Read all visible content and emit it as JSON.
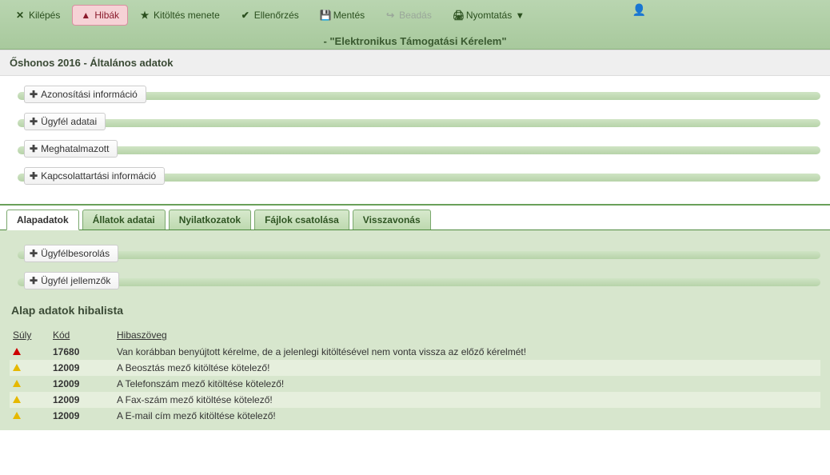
{
  "toolbar": {
    "exit": "Kilépés",
    "errors": "Hibák",
    "fillGuide": "Kitöltés menete",
    "check": "Ellenőrzés",
    "save": "Mentés",
    "submit": "Beadás",
    "print": "Nyomtatás"
  },
  "header": {
    "subtitle": "- \"Elektronikus Támogatási Kérelem\"",
    "pageTitle": "Őshonos 2016 - Általános adatok"
  },
  "accTop": [
    {
      "label": "Azonosítási információ"
    },
    {
      "label": "Ügyfél adatai"
    },
    {
      "label": "Meghatalmazott"
    },
    {
      "label": "Kapcsolattartási információ"
    }
  ],
  "tabs": [
    {
      "label": "Alapadatok",
      "active": true
    },
    {
      "label": "Állatok adatai"
    },
    {
      "label": "Nyilatkozatok"
    },
    {
      "label": "Fájlok csatolása"
    },
    {
      "label": "Visszavonás"
    }
  ],
  "accInner": [
    {
      "label": "Ügyfélbesorolás"
    },
    {
      "label": "Ügyfél jellemzők"
    }
  ],
  "errList": {
    "title": "Alap adatok hibalista",
    "cols": {
      "sev": "Súly",
      "code": "Kód",
      "text": "Hibaszöveg"
    },
    "rows": [
      {
        "sev": "error",
        "code": "17680",
        "text": "Van korábban benyújtott kérelme, de a jelenlegi kitöltésével nem vonta vissza az előző kérelmét!"
      },
      {
        "sev": "warn",
        "code": "12009",
        "text": "A Beosztás mező kitöltése kötelező!"
      },
      {
        "sev": "warn",
        "code": "12009",
        "text": "A Telefonszám mező kitöltése kötelező!"
      },
      {
        "sev": "warn",
        "code": "12009",
        "text": "A Fax-szám mező kitöltése kötelező!"
      },
      {
        "sev": "warn",
        "code": "12009",
        "text": "A E-mail cím mező kitöltése kötelező!"
      }
    ]
  }
}
